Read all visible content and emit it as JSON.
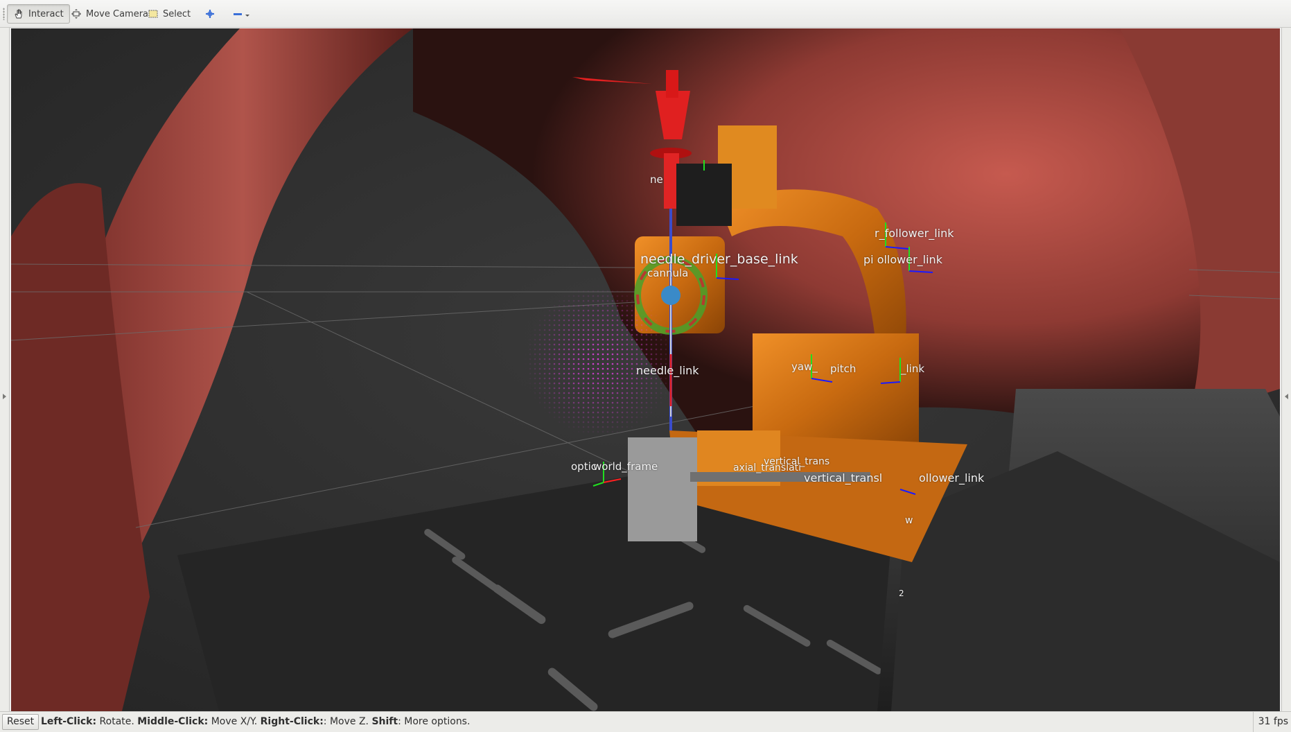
{
  "toolbar": {
    "interact_label": "Interact",
    "move_camera_label": "Move Camera",
    "select_label": "Select",
    "icons": {
      "interact": "hand-icon",
      "move_camera": "camera-move-icon",
      "select": "select-box-icon",
      "focus": "crosshair-plus-icon",
      "remove": "minus-icon",
      "dropdown": "chevron-down-icon"
    }
  },
  "viewport": {
    "labels": [
      {
        "id": "needle-driver-base-link",
        "text": "needle_driver_base_link"
      },
      {
        "id": "cannula",
        "text": "cannula"
      },
      {
        "id": "needle-link",
        "text": "needle_link"
      },
      {
        "id": "top-needle-label",
        "text": "ne"
      },
      {
        "id": "roll-follower-link",
        "text": "r_follower_link"
      },
      {
        "id": "pitch-follower-link",
        "text": "pi   ollower_link"
      },
      {
        "id": "yaw-label",
        "text": "yaw_"
      },
      {
        "id": "pitch-label",
        "text": "pitch"
      },
      {
        "id": "link-label",
        "text": "_link"
      },
      {
        "id": "optical-frame",
        "text": "optic"
      },
      {
        "id": "world-frame",
        "text": "world_frame"
      },
      {
        "id": "axial-translation",
        "text": "axial_translati"
      },
      {
        "id": "vertical-trans-1",
        "text": "vertical_trans"
      },
      {
        "id": "vertical-trans-2",
        "text": "vertical_transl"
      },
      {
        "id": "follower-link-low",
        "text": "ollower_link"
      },
      {
        "id": "w-label",
        "text": "w"
      },
      {
        "id": "two-label",
        "text": "2"
      }
    ],
    "colors": {
      "background": "#303030",
      "model_flesh": "#a64a42",
      "robot_orange": "#d07010",
      "needle_red": "#e02020",
      "pointcloud_magenta": "#e040e0",
      "frame_x": "#ff2020",
      "frame_y": "#20e020",
      "frame_z": "#1a1aff"
    }
  },
  "statusbar": {
    "reset_label": "Reset",
    "help": [
      {
        "key": "Left-Click:",
        "action": "Rotate."
      },
      {
        "key": "Middle-Click:",
        "action": "Move X/Y."
      },
      {
        "key": "Right-Click:",
        "action": ": Move Z."
      },
      {
        "key": "Shift",
        "action": ": More options."
      }
    ],
    "fps": "31 fps"
  }
}
